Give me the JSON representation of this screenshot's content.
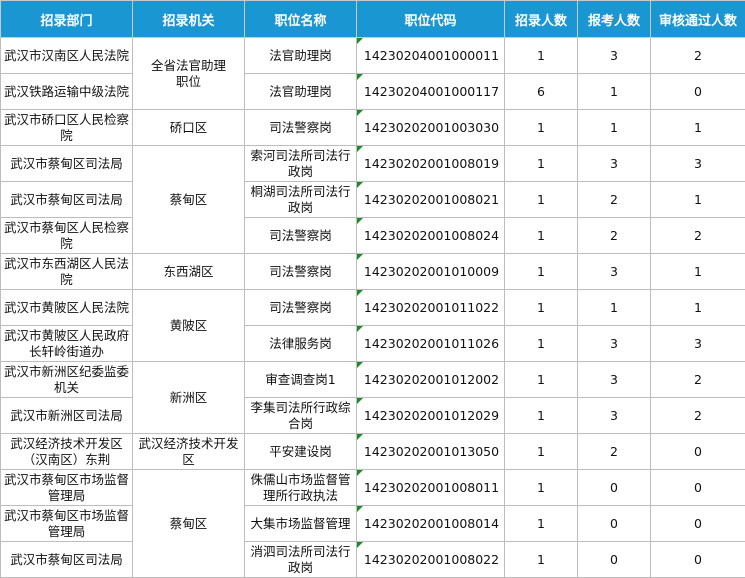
{
  "headers": [
    "招录部门",
    "招录机关",
    "职位名称",
    "职位代码",
    "招录人数",
    "报考人数",
    "审核通过人数"
  ],
  "agencies": [
    "全省法官助理职位",
    "硚口区",
    "蔡甸区",
    "东西湖区",
    "黄陂区",
    "新洲区",
    "武汉经济技术开发区",
    "蔡甸区"
  ],
  "rows": [
    {
      "dept": "武汉市汉南区人民法院",
      "position": "法官助理岗",
      "code": "14230204001000011",
      "recruit": "1",
      "applicants": "3",
      "approved": "2"
    },
    {
      "dept": "武汉铁路运输中级法院",
      "position": "法官助理岗",
      "code": "14230204001000117",
      "recruit": "6",
      "applicants": "1",
      "approved": "0"
    },
    {
      "dept": "武汉市硚口区人民检察院",
      "position": "司法警察岗",
      "code": "14230202001003030",
      "recruit": "1",
      "applicants": "1",
      "approved": "1"
    },
    {
      "dept": "武汉市蔡甸区司法局",
      "position": "索河司法所司法行政岗",
      "code": "14230202001008019",
      "recruit": "1",
      "applicants": "3",
      "approved": "3"
    },
    {
      "dept": "武汉市蔡甸区司法局",
      "position": "桐湖司法所司法行政岗",
      "code": "14230202001008021",
      "recruit": "1",
      "applicants": "2",
      "approved": "1"
    },
    {
      "dept": "武汉市蔡甸区人民检察院",
      "position": "司法警察岗",
      "code": "14230202001008024",
      "recruit": "1",
      "applicants": "2",
      "approved": "2"
    },
    {
      "dept": "武汉市东西湖区人民法院",
      "position": "司法警察岗",
      "code": "14230202001010009",
      "recruit": "1",
      "applicants": "3",
      "approved": "1"
    },
    {
      "dept": "武汉市黄陂区人民法院",
      "position": "司法警察岗",
      "code": "14230202001011022",
      "recruit": "1",
      "applicants": "1",
      "approved": "1"
    },
    {
      "dept": "武汉市黄陂区人民政府长轩岭街道办",
      "position": "法律服务岗",
      "code": "14230202001011026",
      "recruit": "1",
      "applicants": "3",
      "approved": "3"
    },
    {
      "dept": "武汉市新洲区纪委监委机关",
      "position": "审查调查岗1",
      "code": "14230202001012002",
      "recruit": "1",
      "applicants": "3",
      "approved": "2"
    },
    {
      "dept": "武汉市新洲区司法局",
      "position": "李集司法所行政综合岗",
      "code": "14230202001012029",
      "recruit": "1",
      "applicants": "3",
      "approved": "2"
    },
    {
      "dept": "武汉经济技术开发区（汉南区）东荆",
      "position": "平安建设岗",
      "code": "14230202001013050",
      "recruit": "1",
      "applicants": "2",
      "approved": "0"
    },
    {
      "dept": "武汉市蔡甸区市场监督管理局",
      "position": "侏儒山市场监督管理所行政执法",
      "code": "14230202001008011",
      "recruit": "1",
      "applicants": "0",
      "approved": "0"
    },
    {
      "dept": "武汉市蔡甸区市场监督管理局",
      "position": "大集市场监督管理",
      "code": "14230202001008014",
      "recruit": "1",
      "applicants": "0",
      "approved": "0"
    },
    {
      "dept": "武汉市蔡甸区司法局",
      "position": "消泗司法所司法行政岗",
      "code": "14230202001008022",
      "recruit": "1",
      "applicants": "0",
      "approved": "0"
    }
  ]
}
